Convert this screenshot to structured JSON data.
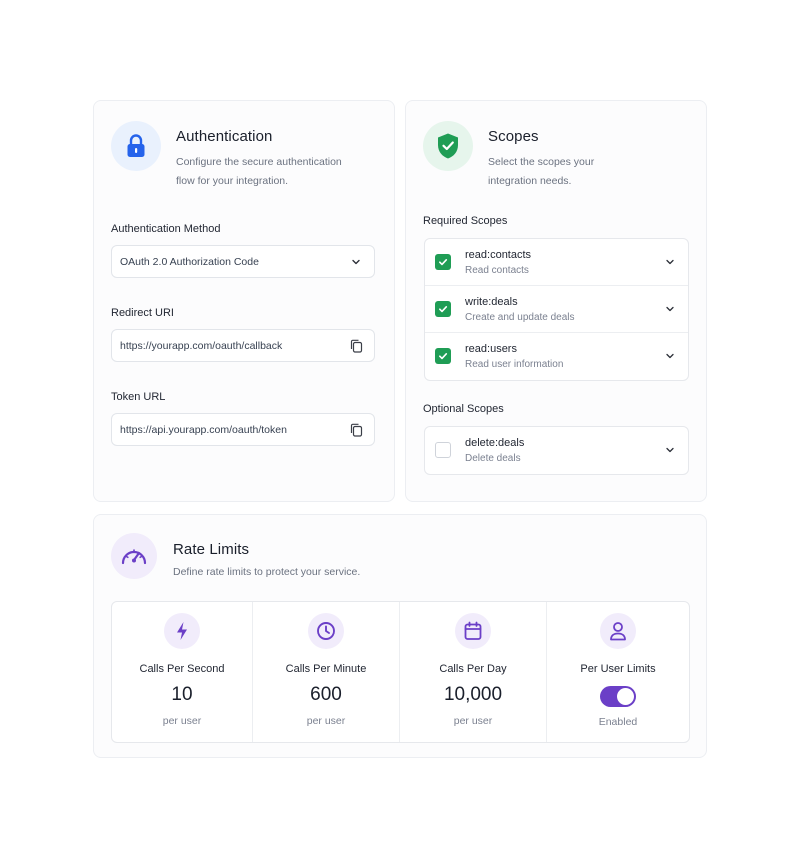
{
  "auth": {
    "title": "Authentication",
    "description_line1": "Configure the secure authentication",
    "description_line2": "flow for your integration.",
    "icon": "lock-icon",
    "method_label": "Authentication Method",
    "method_value": "OAuth 2.0 Authorization Code",
    "redirect_label": "Redirect URI",
    "redirect_value": "https://yourapp.com/oauth/callback",
    "token_label": "Token URL",
    "token_value": "https://api.yourapp.com/oauth/token"
  },
  "scopes": {
    "title": "Scopes",
    "description_line1": "Select the scopes your",
    "description_line2": "integration needs.",
    "icon": "shield-check-icon",
    "required_label": "Required Scopes",
    "required": [
      {
        "name": "read:contacts",
        "desc": "Read contacts",
        "checked": true
      },
      {
        "name": "write:deals",
        "desc": "Create and update deals",
        "checked": true
      },
      {
        "name": "read:users",
        "desc": "Read user information",
        "checked": true
      }
    ],
    "optional_label": "Optional Scopes",
    "optional": [
      {
        "name": "delete:deals",
        "desc": "Delete deals",
        "checked": false
      }
    ]
  },
  "rate_limits": {
    "title": "Rate Limits",
    "description": "Define rate limits to protect your service.",
    "icon": "speedometer-icon",
    "items": [
      {
        "label": "Calls Per Second",
        "value": "10",
        "unit": "per user",
        "icon": "lightning-icon"
      },
      {
        "label": "Calls Per Minute",
        "value": "600",
        "unit": "per user",
        "icon": "clock-icon"
      },
      {
        "label": "Calls Per Day",
        "value": "10,000",
        "unit": "per user",
        "icon": "calendar-icon"
      }
    ],
    "per_user": {
      "label": "Per User Limits",
      "status": "Enabled",
      "enabled": true,
      "icon": "user-icon"
    }
  },
  "colors": {
    "accent_purple": "#6b3fc7",
    "check_green": "#1f9d55",
    "lock_blue": "#2563eb"
  }
}
